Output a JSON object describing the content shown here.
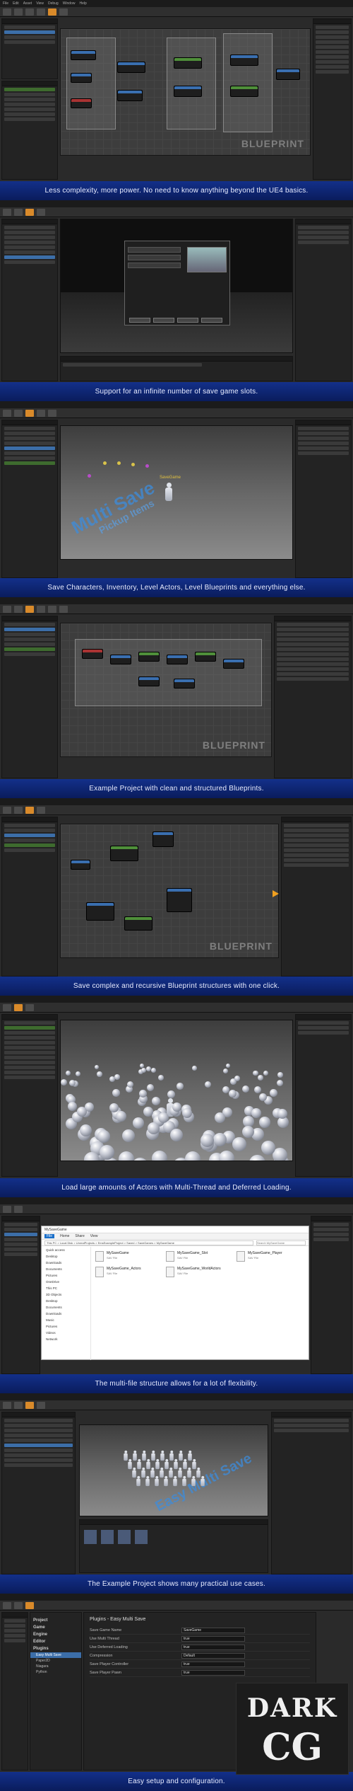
{
  "captions": [
    "Less complexity, more power. No need to know anything beyond the UE4 basics.",
    "Support for an infinite number of save game slots.",
    "Save Characters, Inventory, Level Actors, Level Blueprints and everything else.",
    "Example Project with clean and structured Blueprints.",
    "Save complex and recursive Blueprint structures with one click.",
    "Load large amounts of Actors with Multi-Thread and Deferred Loading.",
    "The multi-file structure allows for a lot of flexibility.",
    "The Example Project shows many practical use cases.",
    "Easy setup and configuration."
  ],
  "editor": {
    "menu": [
      "File",
      "Edit",
      "Asset",
      "View",
      "Debug",
      "Window",
      "Help"
    ],
    "blueprint_watermark": "BLUEPRINT",
    "graph_tab": "Event Graph",
    "viewport_title": "SaveGame"
  },
  "save_dialog": {
    "slots": [
      "SaveGame01",
      "SaveGame02",
      "SaveGame03"
    ],
    "buttons": [
      "Load Game",
      "Save Game",
      "Delete",
      "Back"
    ]
  },
  "level_text": {
    "multi_save": "Multi Save",
    "pickup": "Pickup Items",
    "easy_multi_save": "Easy Multi Save",
    "actor_label": "SaveGame"
  },
  "explorer": {
    "title": "MySaveGame",
    "path": "This PC > Local Disk > UnrealProjects > EmsExampleProject > Saved > SaveGames > MySaveGame",
    "search_placeholder": "Search MySaveGame",
    "tabs": [
      "File",
      "Home",
      "Share",
      "View"
    ],
    "sidebar": [
      "Quick access",
      "Desktop",
      "Downloads",
      "Documents",
      "Pictures",
      "OneDrive",
      "This PC",
      "3D Objects",
      "Desktop",
      "Documents",
      "Downloads",
      "Music",
      "Pictures",
      "Videos",
      "Network"
    ],
    "files": [
      {
        "name": "MySaveGame",
        "type": "SAV File"
      },
      {
        "name": "MySaveGame_Actors",
        "type": "SAV File"
      },
      {
        "name": "MySaveGame_Slot",
        "type": "SAV File"
      },
      {
        "name": "MySaveGame_WorldActors",
        "type": "SAV File"
      },
      {
        "name": "MySaveGame_Player",
        "type": "SAV File"
      }
    ]
  },
  "settings": {
    "title": "Plugins - Easy Multi Save",
    "sections": [
      "Project",
      "Game",
      "Engine",
      "Editor",
      "Plugins"
    ],
    "plugins": [
      "Easy Multi Save",
      "Paper2D",
      "Niagara",
      "Python"
    ],
    "fields": [
      {
        "label": "Save Game Name",
        "value": "SaveGame"
      },
      {
        "label": "Use Multi Thread",
        "value": "true"
      },
      {
        "label": "Use Deferred Loading",
        "value": "true"
      },
      {
        "label": "Compression",
        "value": "Default"
      },
      {
        "label": "Save Player Controller",
        "value": "true"
      },
      {
        "label": "Save Player Pawn",
        "value": "true"
      }
    ]
  },
  "logo": {
    "line1": "DARK",
    "line2": "CG"
  },
  "colors": {
    "caption_bg": "#13308a",
    "accent": "#d98a2a",
    "node_blue": "#3a6fb0"
  }
}
